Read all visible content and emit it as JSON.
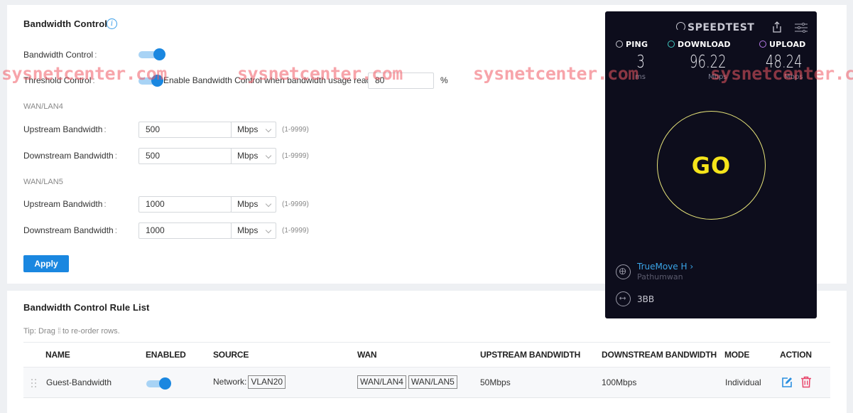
{
  "bandwidth_control": {
    "title": "Bandwidth Control",
    "info_icon": "info-icon",
    "toggle_label": "Bandwidth Control",
    "toggle_enabled": true,
    "threshold_label": "Threshold Control",
    "threshold_enabled": true,
    "threshold_text": "Enable Bandwidth Control when bandwidth usage reaches",
    "threshold_value": "80",
    "threshold_unit": "%",
    "colon": ":",
    "groups": [
      {
        "name": "WAN/LAN4",
        "upstream_label": "Upstream Bandwidth",
        "upstream_value": "500",
        "upstream_unit": "Mbps",
        "downstream_label": "Downstream Bandwidth",
        "downstream_value": "500",
        "downstream_unit": "Mbps",
        "range": "(1-9999)"
      },
      {
        "name": "WAN/LAN5",
        "upstream_label": "Upstream Bandwidth",
        "upstream_value": "1000",
        "upstream_unit": "Mbps",
        "downstream_label": "Downstream Bandwidth",
        "downstream_value": "1000",
        "downstream_unit": "Mbps",
        "range": "(1-9999)"
      }
    ],
    "apply_label": "Apply"
  },
  "rule_list": {
    "title": "Bandwidth Control Rule List",
    "tip_prefix": "Tip: Drag",
    "tip_suffix": "to re-order rows.",
    "columns": [
      "NAME",
      "ENABLED",
      "SOURCE",
      "WAN",
      "UPSTREAM BANDWIDTH",
      "DOWNSTREAM BANDWIDTH",
      "MODE",
      "ACTION"
    ],
    "rows": [
      {
        "name": "Guest-Bandwidth",
        "enabled": true,
        "source_label": "Network:",
        "source_tag": "VLAN20",
        "wan_tags": [
          "WAN/LAN4",
          "WAN/LAN5"
        ],
        "upstream": "50Mbps",
        "downstream": "100Mbps",
        "mode": "Individual"
      }
    ]
  },
  "speedtest": {
    "logo": "SPEEDTEST",
    "ping_label": "PING",
    "ping_value": "3",
    "ping_unit": "ms",
    "download_label": "DOWNLOAD",
    "download_value": "96.22",
    "download_unit": "Mbps",
    "upload_label": "UPLOAD",
    "upload_value": "48.24",
    "upload_unit": "Mbps",
    "go_label": "GO",
    "isp_name": "TrueMove H",
    "isp_location": "Pathumwan",
    "server_name": "3BB",
    "colors": {
      "background": "#0d0d1c",
      "go": "#f5e41a",
      "ping": "#c8c8d2",
      "download": "#3ec7c0",
      "upload": "#b77ae8",
      "isp": "#3aa5e8"
    }
  },
  "watermark": "sysnetcenter.com",
  "colors": {
    "accent": "#1a87e0",
    "delete": "#e8456a",
    "page_bg": "#eef0f3"
  }
}
